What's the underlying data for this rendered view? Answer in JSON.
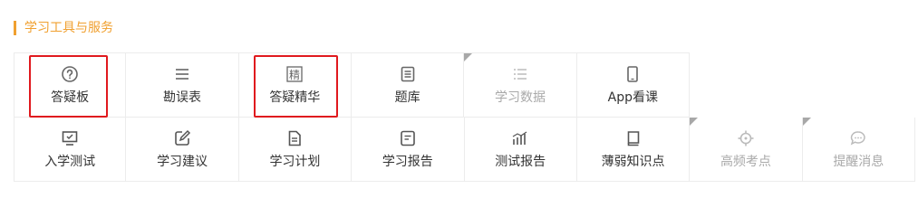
{
  "section": {
    "title": "学习工具与服务"
  },
  "accent_color": "#f0a030",
  "highlight_color": "#e0191e",
  "tools_row1": [
    {
      "label": "答疑板",
      "icon": "question-circle-icon",
      "disabled": false,
      "highlighted": true
    },
    {
      "label": "勘误表",
      "icon": "list-lines-icon",
      "disabled": false,
      "highlighted": false
    },
    {
      "label": "答疑精华",
      "icon": "essence-glyph-icon",
      "glyph": "精",
      "disabled": false,
      "highlighted": true
    },
    {
      "label": "题库",
      "icon": "document-list-icon",
      "disabled": false,
      "highlighted": false
    },
    {
      "label": "学习数据",
      "icon": "bullet-list-icon",
      "disabled": true,
      "highlighted": false
    },
    {
      "label": "App看课",
      "icon": "phone-icon",
      "disabled": false,
      "highlighted": false
    }
  ],
  "tools_row2": [
    {
      "label": "入学测试",
      "icon": "monitor-icon",
      "disabled": false
    },
    {
      "label": "学习建议",
      "icon": "edit-icon",
      "disabled": false
    },
    {
      "label": "学习计划",
      "icon": "plan-document-icon",
      "disabled": false
    },
    {
      "label": "学习报告",
      "icon": "report-icon",
      "disabled": false
    },
    {
      "label": "测试报告",
      "icon": "bar-chart-icon",
      "disabled": false
    },
    {
      "label": "薄弱知识点",
      "icon": "book-icon",
      "disabled": false
    },
    {
      "label": "高频考点",
      "icon": "crosshair-icon",
      "disabled": true
    },
    {
      "label": "提醒消息",
      "icon": "chat-bubble-icon",
      "disabled": true
    }
  ]
}
